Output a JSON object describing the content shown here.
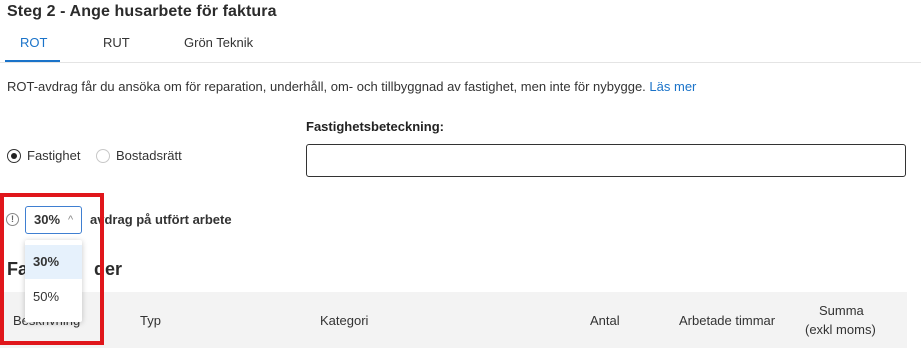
{
  "header": {
    "title": "Steg 2 - Ange husarbete för faktura"
  },
  "tabs": [
    {
      "label": "ROT",
      "active": true
    },
    {
      "label": "RUT",
      "active": false
    },
    {
      "label": "Grön Teknik",
      "active": false
    }
  ],
  "info": {
    "text": "ROT-avdrag får du ansöka om för reparation, underhåll, om- och tillbyggnad av fastighet, men inte för nybygge.",
    "link": "Läs mer"
  },
  "property_type": {
    "options": [
      {
        "label": "Fastighet",
        "checked": true
      },
      {
        "label": "Bostadsrätt",
        "checked": false
      }
    ]
  },
  "property_designation": {
    "label": "Fastighetsbeteckning",
    "colon": ":",
    "value": ""
  },
  "deduction": {
    "info_icon": "info-icon",
    "selected": "30%",
    "options": [
      "30%",
      "50%"
    ],
    "suffix": "avdrag på utfört arbete"
  },
  "rows_section": {
    "title_visible": "Fa",
    "title_tail": "der"
  },
  "table": {
    "columns": [
      "Beskrivning",
      "Typ",
      "Kategori",
      "Antal",
      "Arbetade timmar",
      "Summa",
      "(exkl moms)"
    ]
  },
  "colors": {
    "accent": "#1a73c9",
    "highlight": "#e0161b",
    "selected_bg": "#e6f1fc"
  }
}
